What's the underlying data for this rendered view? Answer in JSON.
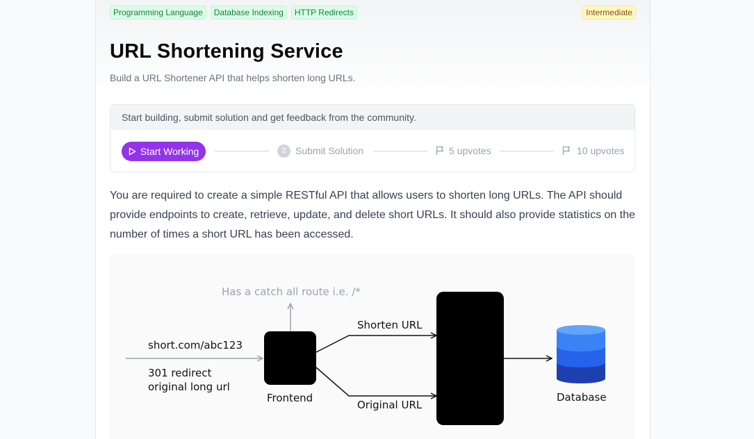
{
  "tags": [
    "Programming Language",
    "Database Indexing",
    "HTTP Redirects"
  ],
  "difficulty": "Intermediate",
  "title": "URL Shortening Service",
  "subtitle": "Build a URL Shortener API that helps shorten long URLs.",
  "progress_card": {
    "header": "Start building, submit solution and get feedback from the community.",
    "start_label": "Start Working",
    "step2_number": "2",
    "step2_label": "Submit Solution",
    "step3_label": "5 upvotes",
    "step4_label": "10 upvotes"
  },
  "description": "You are required to create a simple RESTful API that allows users to shorten long URLs. The API should provide endpoints to create, retrieve, update, and delete short URLs. It should also provide statistics on the number of times a short URL has been accessed.",
  "diagram": {
    "catch_all": "Has a catch all route i.e. /*",
    "short_url": "short.com/abc123",
    "redirect_line1": "301 redirect",
    "redirect_line2": "original long url",
    "frontend": "Frontend",
    "shorten_url": "Shorten URL",
    "original_url": "Original URL",
    "database": "Database"
  },
  "colors": {
    "accent": "#9333ea",
    "tag_text": "#15803d",
    "tag_bg": "#dcfce7",
    "level_bg": "#fef9c3",
    "db_top": "#3b82f6",
    "db_mid": "#2563eb",
    "db_bottom": "#1e40af"
  },
  "icons": [
    "play-icon",
    "flag-icon"
  ]
}
